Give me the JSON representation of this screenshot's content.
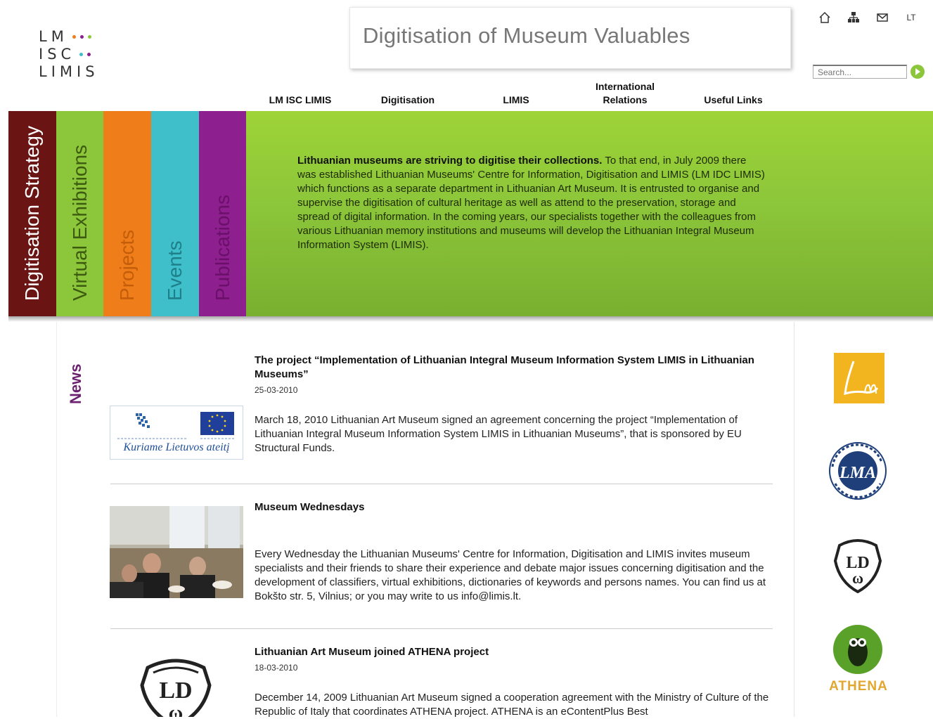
{
  "logo": {
    "line1": "LM",
    "line2": "ISC",
    "line3": "LIMIS"
  },
  "site_title": "Digitisation of Museum Valuables",
  "top_icons": {
    "home": "home-icon",
    "sitemap": "sitemap-icon",
    "mail": "mail-icon",
    "lang": "LT"
  },
  "search": {
    "placeholder": "Search..."
  },
  "nav": [
    {
      "label": "LM ISC LIMIS"
    },
    {
      "label": "Digitisation"
    },
    {
      "label": "LIMIS"
    },
    {
      "label": "International\nRelations"
    },
    {
      "label": "Useful Links"
    }
  ],
  "tabs": [
    {
      "label": "Digitisation Strategy",
      "color": "#6a1414"
    },
    {
      "label": "Virtual Exhibitions",
      "color": "#8cc63a"
    },
    {
      "label": "Projects",
      "color": "#ef7d1a"
    },
    {
      "label": "Events",
      "color": "#3ebfca"
    },
    {
      "label": "Publications",
      "color": "#8e1f8e"
    }
  ],
  "banner": {
    "lead": "Lithuanian museums are striving to digitise their collections.",
    "text": " To that end, in July 2009 there was established Lithuanian Museums' Centre for Information, Digitisation and LIMIS (LM IDC LIMIS) which functions as a separate department in Lithuanian Art Museum. It is entrusted to organise and supervise the digitisation of cultural heritage as well as attend to the preservation, storage and spread of digital information. In the coming years, our specialists together with the colleagues from various Lithuanian memory institutions and museums will develop the Lithuanian Integral Museum Information System (LIMIS)."
  },
  "news_label": "News",
  "news": [
    {
      "title": "The project “Implementation of Lithuanian Integral Museum Information System LIMIS in Lithuanian Museums”",
      "date": "25-03-2010",
      "body": "March 18, 2010 Lithuanian Art Museum signed an agreement concerning the project “Implementation of Lithuanian Integral Museum Information System LIMIS in Lithuanian Museums”, that is sponsored by EU Structural Funds.",
      "image_caption": "Kuriame Lietuvos ateitį"
    },
    {
      "title": "Museum Wednesdays",
      "date": "",
      "body": "Every Wednesday the Lithuanian Museums' Centre for Information, Digitisation and LIMIS invites museum specialists and their friends to share their experience and debate major issues concerning digitisation and the development of classifiers, virtual exhibitions, dictionaries of keywords and persons names. You can find us at Bokšto str. 5, Vilnius; or you may write to us info@limis.lt."
    },
    {
      "title": "Lithuanian Art Museum joined ATHENA project",
      "date": "18-03-2010",
      "body": "December 14, 2009 Lithuanian Art Museum signed a cooperation agreement with the Ministry of Culture of the Republic of Italy that coordinates ATHENA project. ATHENA is an eContentPlus Best"
    }
  ],
  "partners": {
    "athena_label": "ATHENA",
    "lm_label": "Lm",
    "lma_label": "LMA",
    "ldm_label": "LDΩ"
  },
  "colors": {
    "green": "#8cc63a",
    "purple": "#6b1f6f",
    "orange": "#ef7d1a",
    "teal": "#3ebfca"
  }
}
